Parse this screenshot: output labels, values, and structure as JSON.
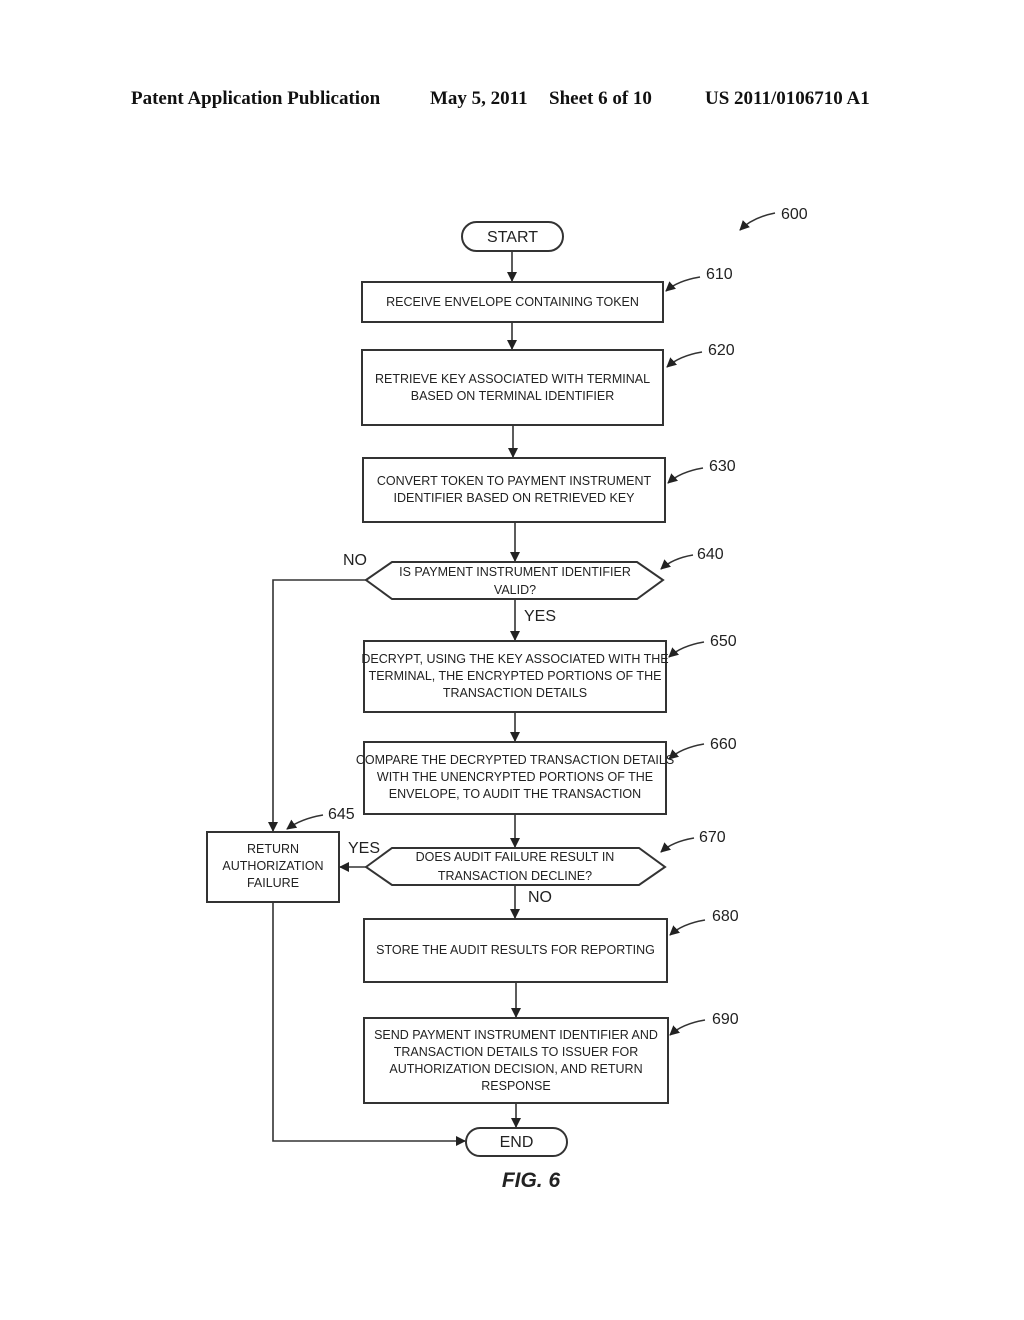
{
  "header": {
    "left": "Patent Application Publication",
    "date": "May 5, 2011",
    "sheet": "Sheet 6 of 10",
    "number": "US 2011/0106710 A1"
  },
  "figure": {
    "ref": "600",
    "caption": "FIG. 6",
    "start": "START",
    "end": "END",
    "steps": {
      "s610": {
        "ref": "610",
        "lines": [
          "RECEIVE ENVELOPE CONTAINING TOKEN"
        ]
      },
      "s620": {
        "ref": "620",
        "lines": [
          "RETRIEVE KEY ASSOCIATED WITH TERMINAL",
          "BASED ON TERMINAL IDENTIFIER"
        ]
      },
      "s630": {
        "ref": "630",
        "lines": [
          "CONVERT TOKEN TO PAYMENT INSTRUMENT",
          "IDENTIFIER BASED ON RETRIEVED KEY"
        ]
      },
      "s640": {
        "ref": "640",
        "lines": [
          "IS PAYMENT INSTRUMENT IDENTIFIER",
          "VALID?"
        ],
        "no": "NO",
        "yes": "YES"
      },
      "s645": {
        "ref": "645",
        "lines": [
          "RETURN",
          "AUTHORIZATION",
          "FAILURE"
        ]
      },
      "s650": {
        "ref": "650",
        "lines": [
          "DECRYPT, USING THE KEY ASSOCIATED WITH THE",
          "TERMINAL, THE ENCRYPTED PORTIONS OF THE",
          "TRANSACTION DETAILS"
        ]
      },
      "s660": {
        "ref": "660",
        "lines": [
          "COMPARE THE DECRYPTED TRANSACTION DETAILS",
          "WITH THE UNENCRYPTED PORTIONS OF THE",
          "ENVELOPE, TO AUDIT THE TRANSACTION"
        ]
      },
      "s670": {
        "ref": "670",
        "lines": [
          "DOES AUDIT FAILURE RESULT IN",
          "TRANSACTION DECLINE?"
        ],
        "yes": "YES",
        "no": "NO"
      },
      "s680": {
        "ref": "680",
        "lines": [
          "STORE THE AUDIT RESULTS FOR REPORTING"
        ]
      },
      "s690": {
        "ref": "690",
        "lines": [
          "SEND PAYMENT INSTRUMENT IDENTIFIER AND",
          "TRANSACTION DETAILS TO ISSUER FOR",
          "AUTHORIZATION DECISION, AND RETURN",
          "RESPONSE"
        ]
      }
    }
  }
}
